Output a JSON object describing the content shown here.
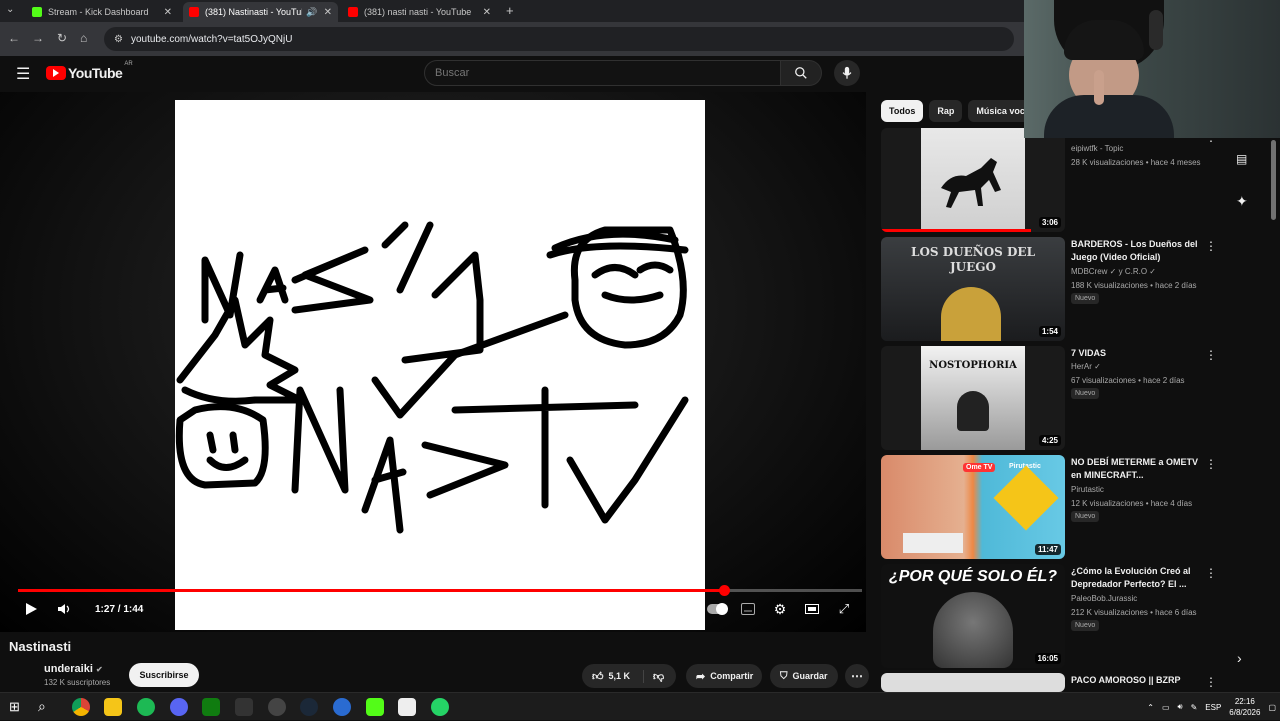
{
  "browser": {
    "tabs": [
      {
        "label": "Stream - Kick Dashboard",
        "active": false
      },
      {
        "label": "(381) Nastinasti - YouTube",
        "active": true
      },
      {
        "label": "(381) nasti nasti - YouTube",
        "active": false
      }
    ],
    "new_tab": "+",
    "url": "youtube.com/watch?v=tat5OJyQNjU"
  },
  "header": {
    "logo_text": "YouTube",
    "country": "AR",
    "search_placeholder": "Buscar"
  },
  "player": {
    "current_time": "1:27",
    "duration": "1:44",
    "time_display": "1:27 / 1:44",
    "progress_fraction": 0.836,
    "video_drawing_text": [
      "NASTY",
      "NASTY"
    ]
  },
  "video": {
    "title": "Nastinasti",
    "channel": "underaiki",
    "subscribers": "132 K suscriptores",
    "subscribe_label": "Suscribirse",
    "likes": "5,1 K",
    "share_label": "Compartir",
    "save_label": "Guardar"
  },
  "chips": [
    "Todos",
    "Rap",
    "Música voca"
  ],
  "recommendations": [
    {
      "title": "",
      "channel": "eipiwtfk - Topic",
      "meta": "28 K visualizaciones • hace 4 meses",
      "badge": "",
      "duration": "3:06"
    },
    {
      "title": "BARDEROS - Los Dueños del Juego (Video Oficial)",
      "channel": "MDBCrew ✓ y C.R.O ✓",
      "meta": "188 K visualizaciones • hace 2 días",
      "badge": "Nuevo",
      "duration": "1:54"
    },
    {
      "title": "7 VIDAS",
      "channel": "HerAr ✓",
      "meta": "67 visualizaciones • hace 2 días",
      "badge": "Nuevo",
      "duration": "4:25"
    },
    {
      "title": "NO DEBÍ METERME a OMETV en MINECRAFT...",
      "channel": "Pirutastic",
      "meta": "12 K visualizaciones • hace 4 días",
      "badge": "Nuevo",
      "duration": "11:47"
    },
    {
      "title": "¿Cómo la Evolución Creó al Depredador Perfecto? El ...",
      "channel": "PaleoBob.Jurassic",
      "meta": "212 K visualizaciones • hace 6 días",
      "badge": "Nuevo",
      "duration": "16:05"
    },
    {
      "title": "PACO AMOROSO || BZRP",
      "channel": "",
      "meta": "",
      "badge": "",
      "duration": ""
    }
  ],
  "thumb_texts": {
    "los_duenos": "LOS DUEÑOS DEL JUEGO",
    "nostophoria": "NOSTOPHORIA",
    "por_que": "¿POR QUÉ SOLO ÉL?",
    "ome": "Ome TV",
    "pirutastic": "Pirutastic"
  },
  "taskbar": {
    "language": "ESP",
    "time": "22:16",
    "date": "6/8/2026"
  },
  "colors": {
    "accent_red": "#ff0000",
    "background": "#0f0f0f",
    "chip_bg": "#272727"
  }
}
